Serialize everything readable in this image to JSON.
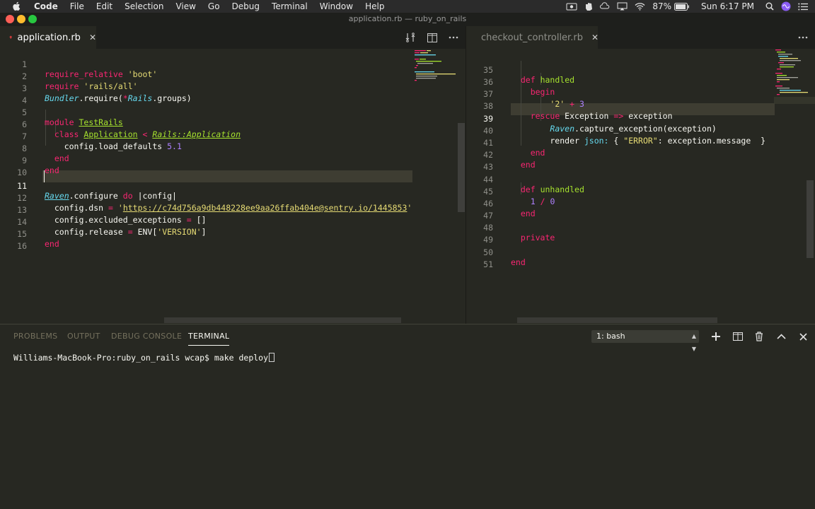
{
  "menubar": {
    "app": "Code",
    "items": [
      "File",
      "Edit",
      "Selection",
      "View",
      "Go",
      "Debug",
      "Terminal",
      "Window",
      "Help"
    ],
    "battery": "87%",
    "clock": "Sun 6:17 PM"
  },
  "window": {
    "title": "application.rb — ruby_on_rails"
  },
  "left_editor": {
    "tab_label": "application.rb",
    "lines": [
      {
        "n": "1",
        "code": "require_relative 'boot'"
      },
      {
        "n": "2",
        "code": "require 'rails/all'"
      },
      {
        "n": "3",
        "code": "Bundler.require(*Rails.groups)"
      },
      {
        "n": "4",
        "code": ""
      },
      {
        "n": "5",
        "code": "module TestRails"
      },
      {
        "n": "6",
        "code": "  class Application < Rails::Application"
      },
      {
        "n": "7",
        "code": "    config.load_defaults 5.1"
      },
      {
        "n": "8",
        "code": "  end"
      },
      {
        "n": "9",
        "code": "end"
      },
      {
        "n": "10",
        "code": ""
      },
      {
        "n": "11",
        "code": "Raven.configure do |config|"
      },
      {
        "n": "12",
        "code": "  config.dsn = 'https://c74d756a9db448228ee9aa26ffab404e@sentry.io/1445853'"
      },
      {
        "n": "13",
        "code": "  config.excluded_exceptions = []"
      },
      {
        "n": "14",
        "code": "  config.release = ENV['VERSION']"
      },
      {
        "n": "15",
        "code": "end"
      },
      {
        "n": "16",
        "code": ""
      }
    ]
  },
  "right_editor": {
    "tab_label": "checkout_controller.rb",
    "lines": [
      {
        "n": "35",
        "code": "  def handled"
      },
      {
        "n": "36",
        "code": "    begin"
      },
      {
        "n": "37",
        "code": "        '2' + 3"
      },
      {
        "n": "38",
        "code": "    rescue Exception => exception"
      },
      {
        "n": "39",
        "code": "        Raven.capture_exception(exception)"
      },
      {
        "n": "40",
        "code": "        render json: { \"ERROR\": exception.message  }"
      },
      {
        "n": "41",
        "code": "    end"
      },
      {
        "n": "42",
        "code": "  end"
      },
      {
        "n": "43",
        "code": ""
      },
      {
        "n": "44",
        "code": "  def unhandled"
      },
      {
        "n": "45",
        "code": "    1 / 0"
      },
      {
        "n": "46",
        "code": "  end"
      },
      {
        "n": "47",
        "code": ""
      },
      {
        "n": "48",
        "code": "  private"
      },
      {
        "n": "49",
        "code": ""
      },
      {
        "n": "50",
        "code": "end"
      },
      {
        "n": "51",
        "code": ""
      }
    ]
  },
  "panel": {
    "tabs": [
      "PROBLEMS",
      "OUTPUT",
      "DEBUG CONSOLE",
      "TERMINAL"
    ],
    "active_tab": "TERMINAL",
    "terminal_select": "1: bash",
    "terminal_line": "Williams-MacBook-Pro:ruby_on_rails wcap$ make deploy"
  },
  "icons": {
    "tab_file": "ruby-icon",
    "tab_close": "close-icon",
    "compare": "open-changes-icon",
    "split": "split-editor-icon",
    "more": "more-actions-icon",
    "add": "plus-icon",
    "trash": "trash-icon",
    "maximize": "chevron-up-icon"
  },
  "colors": {
    "background": "#272822",
    "keyword": "#f92672",
    "string": "#e6db74",
    "number": "#ae81ff",
    "class": "#66d9ef",
    "function": "#a6e22e"
  }
}
